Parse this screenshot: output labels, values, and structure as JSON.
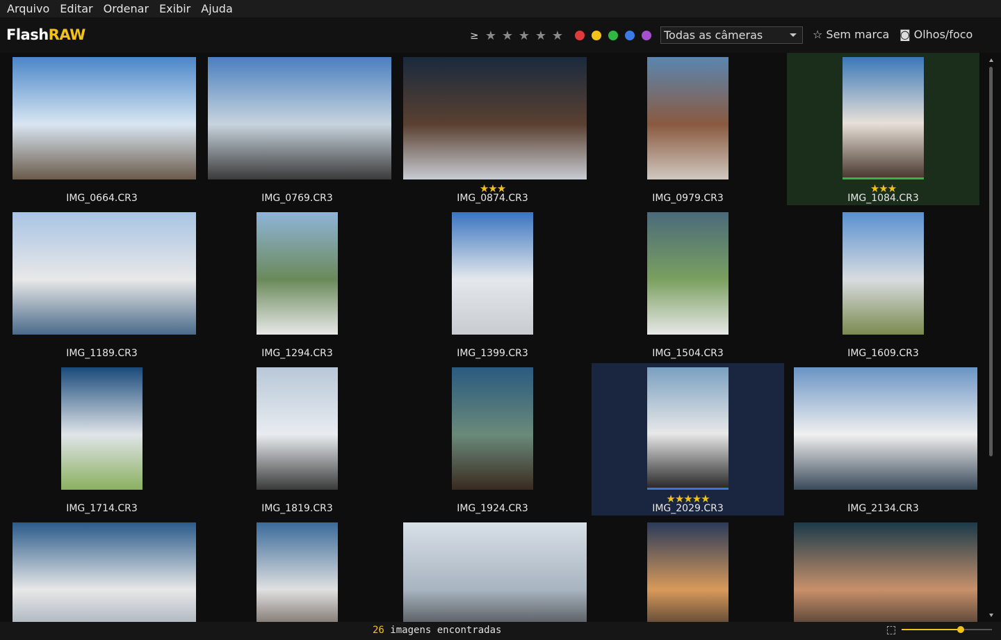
{
  "menu": [
    "Arquivo",
    "Editar",
    "Ordenar",
    "Exibir",
    "Ajuda"
  ],
  "app": {
    "logo_part1": "Flash",
    "logo_part2": "RAW"
  },
  "toolbar": {
    "rating_prefix": "≥",
    "rating_star_glyph": "★",
    "rating_filter_count": 5,
    "color_labels": [
      {
        "name": "red",
        "color": "#e03a3a"
      },
      {
        "name": "yellow",
        "color": "#f2c21a"
      },
      {
        "name": "green",
        "color": "#2eb843"
      },
      {
        "name": "blue",
        "color": "#3a7be8"
      },
      {
        "name": "purple",
        "color": "#a64fd1"
      }
    ],
    "camera_filter": "Todas as câmeras",
    "unmarked_label": "☆ Sem marca",
    "eyes_focus_label": "◙ Olhos/foco"
  },
  "images": [
    {
      "file": "IMG_0664.CR3",
      "orientation": "landscape",
      "stars": "",
      "selected": "",
      "colors": [
        "#4a86c8",
        "#d9e6f2",
        "#6a5a4a"
      ]
    },
    {
      "file": "IMG_0769.CR3",
      "orientation": "landscape",
      "stars": "",
      "selected": "",
      "colors": [
        "#4a7fc0",
        "#c8d4de",
        "#3a3a3a"
      ]
    },
    {
      "file": "IMG_0874.CR3",
      "orientation": "landscape",
      "stars": "★★★",
      "selected": "",
      "colors": [
        "#1a2a3e",
        "#5a4030",
        "#c8ccd4"
      ]
    },
    {
      "file": "IMG_0979.CR3",
      "orientation": "portrait",
      "stars": "",
      "selected": "",
      "colors": [
        "#5a86b0",
        "#8a5a40",
        "#d0c8c0"
      ]
    },
    {
      "file": "IMG_1084.CR3",
      "orientation": "portrait",
      "stars": "★★★",
      "selected": "green",
      "colors": [
        "#3a78b8",
        "#e8e0d8",
        "#4a3a30"
      ]
    },
    {
      "file": "IMG_1189.CR3",
      "orientation": "landscape",
      "stars": "",
      "selected": "",
      "colors": [
        "#a8c4e4",
        "#e8e8e8",
        "#4a6a8a"
      ]
    },
    {
      "file": "IMG_1294.CR3",
      "orientation": "portrait",
      "stars": "",
      "selected": "",
      "colors": [
        "#8fb4d8",
        "#6a8a5a",
        "#e8e8e8"
      ]
    },
    {
      "file": "IMG_1399.CR3",
      "orientation": "portrait",
      "stars": "",
      "selected": "",
      "colors": [
        "#3a74c0",
        "#e4e8ec",
        "#c8ccd0"
      ]
    },
    {
      "file": "IMG_1504.CR3",
      "orientation": "portrait",
      "stars": "",
      "selected": "",
      "colors": [
        "#4a6a7a",
        "#7aa060",
        "#e8e8e8"
      ]
    },
    {
      "file": "IMG_1609.CR3",
      "orientation": "portrait",
      "stars": "",
      "selected": "",
      "colors": [
        "#5a90d0",
        "#d8dce0",
        "#7a8a50"
      ]
    },
    {
      "file": "IMG_1714.CR3",
      "orientation": "portrait",
      "stars": "",
      "selected": "",
      "colors": [
        "#1a4a7a",
        "#e0e4e8",
        "#8ab060"
      ]
    },
    {
      "file": "IMG_1819.CR3",
      "orientation": "portrait",
      "stars": "",
      "selected": "",
      "colors": [
        "#b8c8d8",
        "#e8ecf0",
        "#3a3a3a"
      ]
    },
    {
      "file": "IMG_1924.CR3",
      "orientation": "portrait",
      "stars": "",
      "selected": "",
      "colors": [
        "#2a5a80",
        "#6a8a7a",
        "#3a2a20"
      ]
    },
    {
      "file": "IMG_2029.CR3",
      "orientation": "portrait",
      "stars": "★★★★★",
      "selected": "blue",
      "colors": [
        "#7aa0c0",
        "#e8e8e8",
        "#2a2a2a"
      ]
    },
    {
      "file": "IMG_2134.CR3",
      "orientation": "landscape",
      "stars": "",
      "selected": "",
      "colors": [
        "#6a94c4",
        "#f0f0f0",
        "#3a4a5a"
      ]
    },
    {
      "file": "",
      "orientation": "landscape",
      "stars": "",
      "selected": "",
      "colors": [
        "#2a5a8a",
        "#e8e8e8",
        "#8a9aa8"
      ]
    },
    {
      "file": "",
      "orientation": "portrait",
      "stars": "",
      "selected": "",
      "colors": [
        "#3a6a9a",
        "#e0e0e0",
        "#4a3a30"
      ]
    },
    {
      "file": "",
      "orientation": "landscape",
      "stars": "",
      "selected": "",
      "colors": [
        "#d8e0e8",
        "#a8b4c0",
        "#2a2a2a"
      ]
    },
    {
      "file": "",
      "orientation": "portrait",
      "stars": "",
      "selected": "",
      "colors": [
        "#2a3a5a",
        "#d89a5a",
        "#1a1a20"
      ]
    },
    {
      "file": "",
      "orientation": "landscape",
      "stars": "",
      "selected": "",
      "colors": [
        "#1a3a4a",
        "#c8906a",
        "#1a1a1a"
      ]
    }
  ],
  "status": {
    "count": "26",
    "count_label": "imagens encontradas",
    "zoom_level": 0.65
  }
}
